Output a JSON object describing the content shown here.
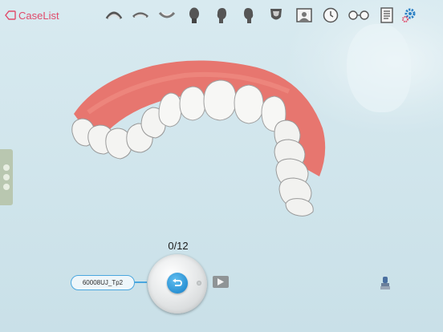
{
  "header": {
    "back_label": "CaseList",
    "back_icon": "back-tab-icon"
  },
  "toolbar": {
    "tools": [
      "upper-arch-front-icon",
      "upper-arch-top-icon",
      "lower-arch-icon",
      "head-front-icon",
      "head-left-icon",
      "head-right-icon",
      "jaw-icon",
      "photo-frame-icon",
      "clock-icon",
      "glasses-icon",
      "document-icon",
      "settings-icon"
    ]
  },
  "viewer": {
    "step_counter": "0/12",
    "case_name": "60008UJ_Tp2",
    "colors": {
      "gum": "#e7766f",
      "tooth": "#f4f4f2",
      "accent": "#e04a6a",
      "dial": "#2a91d4"
    }
  },
  "controls": {
    "dial_icon": "undo-icon",
    "play_icon": "play-icon",
    "stamp_icon": "stamp-icon"
  }
}
